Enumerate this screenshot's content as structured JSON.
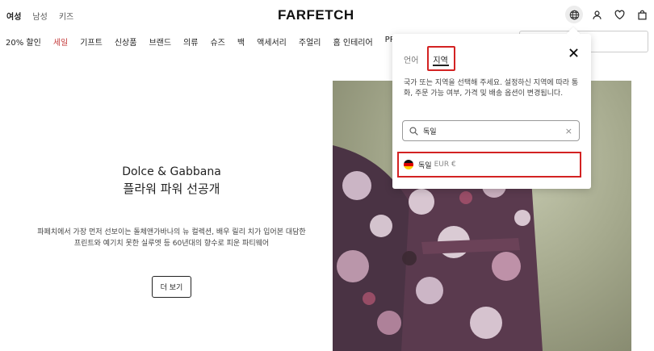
{
  "header": {
    "gender_tabs": [
      "여성",
      "남성",
      "키즈"
    ],
    "logo": "FARFETCH",
    "icons": [
      "globe-icon",
      "account-icon",
      "wishlist-heart-icon",
      "shopping-bag-icon"
    ]
  },
  "nav": {
    "items": [
      "20% 할인",
      "세일",
      "기프트",
      "신상품",
      "브랜드",
      "의류",
      "슈즈",
      "백",
      "액세서리",
      "주얼리",
      "홈 인테리어",
      "PR"
    ]
  },
  "hero": {
    "brand": "Dolce & Gabbana",
    "headline": "플라워 파워 선공개",
    "description": "파페치에서 가장 먼저 선보이는 돌체앤가바나의 뉴 컬렉션, 배우 릴리 치가 입어본 대담한 프린트와 예기치 못한 실루엣 등 60년대의 향수로 피운 파티웨어",
    "cta": "더 보기"
  },
  "popover": {
    "tabs": [
      "언어",
      "지역"
    ],
    "active_tab": "지역",
    "description": "국가 또는 지역을 선택해 주세요. 설정하신 지역에 따라 통화, 주문 가능 여부, 가격 및 배송 옵션이 변경됩니다.",
    "search_value": "독일",
    "result": {
      "country": "독일",
      "currency": "EUR €"
    }
  },
  "colors": {
    "sale": "#c43a3a",
    "highlight": "#d32222"
  }
}
